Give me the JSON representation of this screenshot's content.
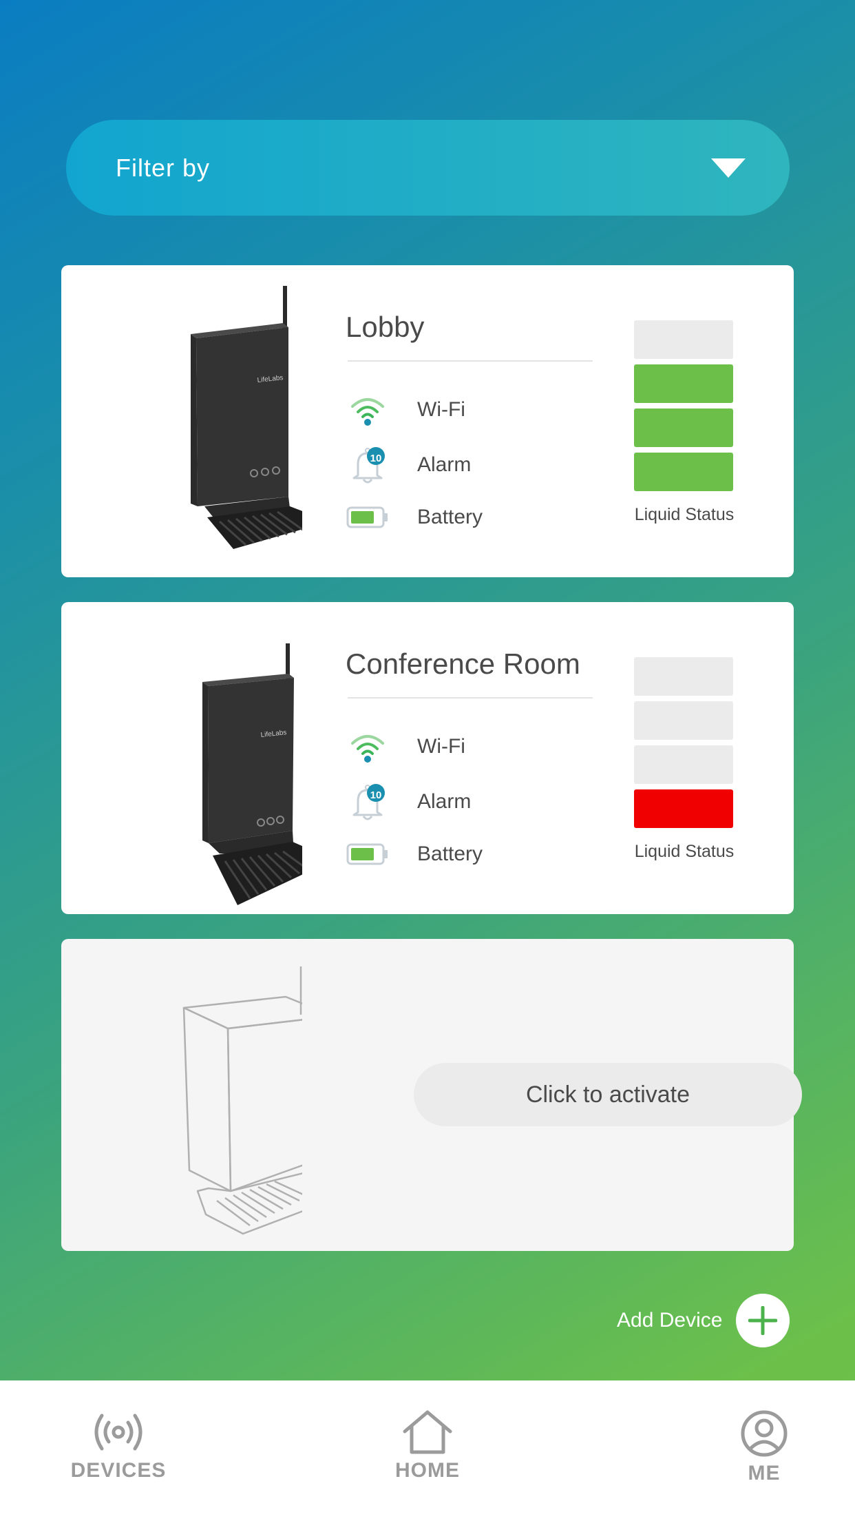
{
  "filter": {
    "label": "Filter by"
  },
  "devices": [
    {
      "title": "Lobby",
      "wifi_label": "Wi-Fi",
      "alarm_label": "Alarm",
      "alarm_count": "10",
      "battery_label": "Battery",
      "liquid_label": "Liquid Status",
      "liquid_level_segments": 3,
      "liquid_color": "#6cc04a"
    },
    {
      "title": "Conference Room",
      "wifi_label": "Wi-Fi",
      "alarm_label": "Alarm",
      "alarm_count": "10",
      "battery_label": "Battery",
      "liquid_label": "Liquid Status",
      "liquid_level_segments": 1,
      "liquid_color": "#f00000"
    }
  ],
  "inactive_card": {
    "button_label": "Click to activate"
  },
  "add_device": {
    "label": "Add Device",
    "icon": "plus-icon"
  },
  "nav": {
    "devices": {
      "label": "DEVICES",
      "icon": "broadcast-icon"
    },
    "home": {
      "label": "HOME",
      "icon": "home-icon"
    },
    "me": {
      "label": "ME",
      "icon": "user-icon"
    }
  },
  "colors": {
    "accent_green": "#6cc04a",
    "alert_red": "#f00000",
    "alarm_badge": "#1a8fb0",
    "wifi_green": "#3cb55a"
  }
}
